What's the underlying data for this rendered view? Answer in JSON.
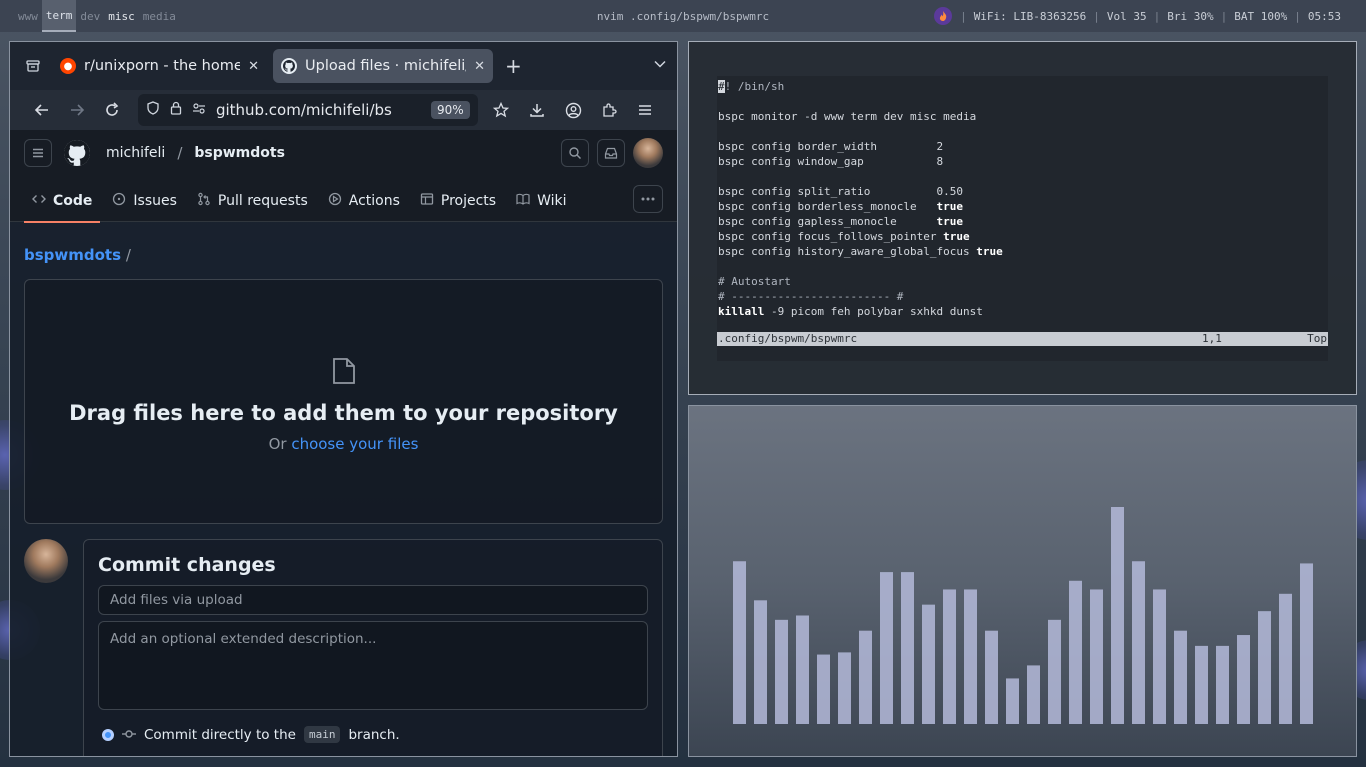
{
  "topbar": {
    "workspaces": [
      {
        "label": "www",
        "state": "empty"
      },
      {
        "label": "term",
        "state": "active"
      },
      {
        "label": "dev",
        "state": "empty"
      },
      {
        "label": "misc",
        "state": "occupied"
      },
      {
        "label": "media",
        "state": "empty"
      }
    ],
    "title": "nvim .config/bspwm/bspwmrc",
    "wifi": "WiFi: LIB-8363256",
    "volume": "Vol 35",
    "brightness": "Bri 30%",
    "battery": "BAT 100%",
    "clock": "05:53",
    "sep": "|"
  },
  "browser": {
    "tabs": [
      {
        "title": "r/unixporn - the home fo",
        "favicon": "reddit-icon",
        "color": "#ff4500"
      },
      {
        "title": "Upload files · michifeli/b",
        "favicon": "github-icon",
        "color": "#e6edf3"
      }
    ],
    "new_tab": "+",
    "url": "github.com/michifeli/bs",
    "zoom": "90%"
  },
  "github": {
    "owner": "michifeli",
    "slash": "/",
    "repo": "bspwmdots",
    "nav": [
      {
        "label": "Code",
        "icon": "code-icon",
        "selected": true
      },
      {
        "label": "Issues",
        "icon": "issue-icon",
        "selected": false
      },
      {
        "label": "Pull requests",
        "icon": "pull-request-icon",
        "selected": false
      },
      {
        "label": "Actions",
        "icon": "play-icon",
        "selected": false
      },
      {
        "label": "Projects",
        "icon": "table-icon",
        "selected": false
      },
      {
        "label": "Wiki",
        "icon": "book-icon",
        "selected": false
      }
    ],
    "breadcrumb_repo": "bspwmdots",
    "breadcrumb_sep": "/",
    "drop_heading": "Drag files here to add them to your repository",
    "drop_or": "Or ",
    "drop_link": "choose your files",
    "commit_heading": "Commit changes",
    "commit_placeholder": "Add files via upload",
    "description_placeholder": "Add an optional extended description...",
    "commit_option_prefix": "Commit directly to the",
    "commit_branch": "main",
    "commit_option_suffix": "branch."
  },
  "terminal": {
    "lines": [
      {
        "segments": [
          {
            "t": "#",
            "c": "cursor"
          },
          {
            "t": "! /bin/sh",
            "c": "cm"
          }
        ]
      },
      {
        "segments": []
      },
      {
        "segments": [
          {
            "t": "bspc monitor -d www term dev misc media",
            "c": ""
          }
        ]
      },
      {
        "segments": []
      },
      {
        "segments": [
          {
            "t": "bspc config border_width         2",
            "c": ""
          }
        ]
      },
      {
        "segments": [
          {
            "t": "bspc config window_gap           8",
            "c": ""
          }
        ]
      },
      {
        "segments": []
      },
      {
        "segments": [
          {
            "t": "bspc config split_ratio          0.50",
            "c": ""
          }
        ]
      },
      {
        "segments": [
          {
            "t": "bspc config borderless_monocle   ",
            "c": ""
          },
          {
            "t": "true",
            "c": "kw"
          }
        ]
      },
      {
        "segments": [
          {
            "t": "bspc config gapless_monocle      ",
            "c": ""
          },
          {
            "t": "true",
            "c": "kw"
          }
        ]
      },
      {
        "segments": [
          {
            "t": "bspc config focus_follows_pointer ",
            "c": ""
          },
          {
            "t": "true",
            "c": "kw"
          }
        ]
      },
      {
        "segments": [
          {
            "t": "bspc config history_aware_global_focus ",
            "c": ""
          },
          {
            "t": "true",
            "c": "kw"
          }
        ]
      },
      {
        "segments": []
      },
      {
        "segments": [
          {
            "t": "# Autostart",
            "c": "cm"
          }
        ]
      },
      {
        "segments": [
          {
            "t": "# ------------------------ #",
            "c": "cm"
          }
        ]
      },
      {
        "segments": [
          {
            "t": "killall",
            "c": "kw"
          },
          {
            "t": " -9 picom feh polybar sxhkd dunst",
            "c": ""
          }
        ]
      }
    ],
    "status_file": ".config/bspwm/bspwmrc",
    "status_pos": "1,1",
    "status_pct": "Top"
  },
  "visualizer": {
    "levels": [
      0.75,
      0.57,
      0.48,
      0.5,
      0.32,
      0.33,
      0.43,
      0.7,
      0.7,
      0.55,
      0.62,
      0.62,
      0.43,
      0.21,
      0.27,
      0.48,
      0.66,
      0.62,
      1.0,
      0.75,
      0.62,
      0.43,
      0.36,
      0.36,
      0.41,
      0.52,
      0.6,
      0.74
    ],
    "bar_color": "#b4bad9"
  }
}
